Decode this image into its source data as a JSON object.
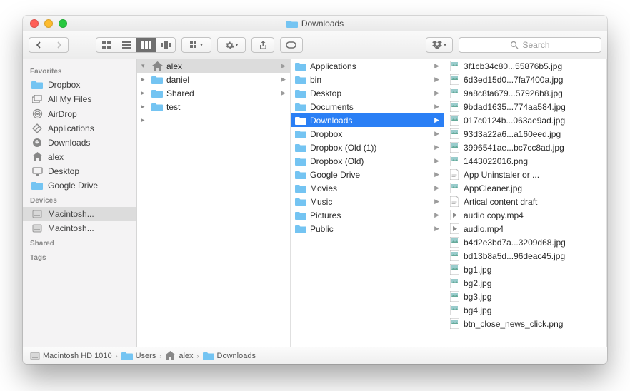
{
  "window": {
    "title": "Downloads"
  },
  "toolbar": {
    "search_placeholder": "Search"
  },
  "sidebar": {
    "sections": [
      {
        "title": "Favorites",
        "items": [
          {
            "icon": "folder",
            "label": "Dropbox"
          },
          {
            "icon": "allfiles",
            "label": "All My Files"
          },
          {
            "icon": "airdrop",
            "label": "AirDrop"
          },
          {
            "icon": "apps",
            "label": "Applications"
          },
          {
            "icon": "downloads",
            "label": "Downloads"
          },
          {
            "icon": "home",
            "label": "alex"
          },
          {
            "icon": "desktop",
            "label": "Desktop"
          },
          {
            "icon": "folder",
            "label": "Google Drive"
          }
        ]
      },
      {
        "title": "Devices",
        "items": [
          {
            "icon": "disk",
            "label": "Macintosh...",
            "selected": true
          },
          {
            "icon": "disk",
            "label": "Macintosh..."
          }
        ]
      },
      {
        "title": "Shared",
        "items": []
      },
      {
        "title": "Tags",
        "items": []
      }
    ]
  },
  "columns": [
    [
      {
        "icon": "home",
        "label": "alex",
        "arrow": true,
        "sel": "gray",
        "exp": "open"
      },
      {
        "icon": "folder",
        "label": "daniel",
        "arrow": true,
        "exp": "closed"
      },
      {
        "icon": "folder",
        "label": "Shared",
        "arrow": true,
        "exp": "closed"
      },
      {
        "icon": "folder",
        "label": "test",
        "exp": "closed"
      }
    ],
    [
      {
        "icon": "folder",
        "label": "Applications",
        "arrow": true
      },
      {
        "icon": "folder",
        "label": "bin",
        "arrow": true
      },
      {
        "icon": "folder",
        "label": "Desktop",
        "arrow": true
      },
      {
        "icon": "folder",
        "label": "Documents",
        "arrow": true
      },
      {
        "icon": "folder",
        "label": "Downloads",
        "arrow": true,
        "sel": "blue"
      },
      {
        "icon": "folder",
        "label": "Dropbox",
        "arrow": true
      },
      {
        "icon": "folder",
        "label": "Dropbox (Old (1))",
        "arrow": true
      },
      {
        "icon": "folder",
        "label": "Dropbox (Old)",
        "arrow": true
      },
      {
        "icon": "folder",
        "label": "Google Drive",
        "arrow": true
      },
      {
        "icon": "folder",
        "label": "Movies",
        "arrow": true
      },
      {
        "icon": "folder",
        "label": "Music",
        "arrow": true
      },
      {
        "icon": "folder",
        "label": "Pictures",
        "arrow": true
      },
      {
        "icon": "folder",
        "label": "Public",
        "arrow": true
      }
    ],
    [
      {
        "icon": "img",
        "label": "3f1cb34c80...55876b5.jpg"
      },
      {
        "icon": "img",
        "label": "6d3ed15d0...7fa7400a.jpg"
      },
      {
        "icon": "img",
        "label": "9a8c8fa679...57926b8.jpg"
      },
      {
        "icon": "img",
        "label": "9bdad1635...774aa584.jpg"
      },
      {
        "icon": "img",
        "label": "017c0124b...063ae9ad.jpg"
      },
      {
        "icon": "img",
        "label": "93d3a22a6...a160eed.jpg"
      },
      {
        "icon": "img",
        "label": "3996541ae...bc7cc8ad.jpg"
      },
      {
        "icon": "img",
        "label": "1443022016.png"
      },
      {
        "icon": "file",
        "label": "App Uninstaler or ..."
      },
      {
        "icon": "img",
        "label": "AppCleaner.jpg"
      },
      {
        "icon": "file",
        "label": "Artical content draft"
      },
      {
        "icon": "media",
        "label": "audio copy.mp4"
      },
      {
        "icon": "media",
        "label": "audio.mp4"
      },
      {
        "icon": "img",
        "label": "b4d2e3bd7a...3209d68.jpg"
      },
      {
        "icon": "img",
        "label": "bd13b8a5d...96deac45.jpg"
      },
      {
        "icon": "img",
        "label": "bg1.jpg"
      },
      {
        "icon": "img",
        "label": "bg2.jpg"
      },
      {
        "icon": "img",
        "label": "bg3.jpg"
      },
      {
        "icon": "img",
        "label": "bg4.jpg"
      },
      {
        "icon": "img",
        "label": "btn_close_news_click.png"
      }
    ]
  ],
  "path": [
    {
      "icon": "disk",
      "label": "Macintosh HD 1010"
    },
    {
      "icon": "folder",
      "label": "Users"
    },
    {
      "icon": "home",
      "label": "alex"
    },
    {
      "icon": "folder",
      "label": "Downloads"
    }
  ]
}
